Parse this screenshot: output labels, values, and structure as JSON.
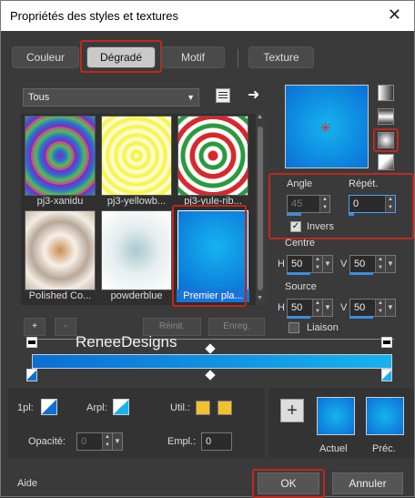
{
  "title": "Propriétés des styles et textures",
  "tabs": {
    "couleur": "Couleur",
    "degrade": "Dégradé",
    "motif": "Motif",
    "texture": "Texture"
  },
  "dropdown": {
    "value": "Tous"
  },
  "thumbs": [
    {
      "label": "pj3-xanidu"
    },
    {
      "label": "pj3-yellowb..."
    },
    {
      "label": "pj3-yule-rib..."
    },
    {
      "label": "Polished Co..."
    },
    {
      "label": "powderblue"
    },
    {
      "label": "Premier pla..."
    }
  ],
  "thumbActions": {
    "add": "+",
    "remove": "-",
    "reset": "Réinit.",
    "save": "Enreg."
  },
  "angle": {
    "label": "Angle",
    "value": "45"
  },
  "repeat": {
    "label": "Répét.",
    "value": "0"
  },
  "invert": {
    "label": "Invers",
    "checked": true
  },
  "centre": {
    "label": "Centre",
    "h_label": "H",
    "h_value": "50",
    "v_label": "V",
    "v_value": "50"
  },
  "source": {
    "label": "Source",
    "h_label": "H",
    "h_value": "50",
    "v_label": "V",
    "v_value": "50"
  },
  "link": {
    "label": "Liaison",
    "checked": false
  },
  "watermark": "ReneeDesigns",
  "stop": {
    "first_label": "1pl:",
    "arpl_label": "Arpl:",
    "util_label": "Util.:",
    "opacity_label": "Opacité:",
    "opacity_value": "0",
    "empl_label": "Empl.:",
    "empl_value": "0"
  },
  "swatches": {
    "current": "Actuel",
    "previous": "Préc."
  },
  "help": "Aide",
  "ok": "OK",
  "cancel": "Annuler",
  "colors": {
    "accent": "#c0281c",
    "gradient_dark": "#0a6fd6",
    "gradient_light": "#16b3ef",
    "util": "#f2c12e"
  }
}
